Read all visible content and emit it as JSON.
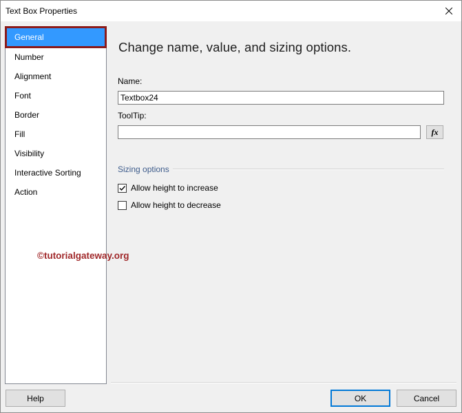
{
  "window": {
    "title": "Text Box Properties"
  },
  "nav": {
    "items": [
      {
        "label": "General",
        "selected": true
      },
      {
        "label": "Number"
      },
      {
        "label": "Alignment"
      },
      {
        "label": "Font"
      },
      {
        "label": "Border"
      },
      {
        "label": "Fill"
      },
      {
        "label": "Visibility"
      },
      {
        "label": "Interactive Sorting"
      },
      {
        "label": "Action"
      }
    ]
  },
  "main": {
    "heading": "Change name, value, and sizing options.",
    "name_label": "Name:",
    "name_value": "Textbox24",
    "tooltip_label": "ToolTip:",
    "tooltip_value": "",
    "fx_label": "fx",
    "sizing_title": "Sizing options",
    "allow_increase_label": "Allow height to increase",
    "allow_increase_checked": true,
    "allow_decrease_label": "Allow height to decrease",
    "allow_decrease_checked": false
  },
  "watermark": "©tutorialgateway.org",
  "buttons": {
    "help": "Help",
    "ok": "OK",
    "cancel": "Cancel"
  },
  "colors": {
    "selection": "#3399ff",
    "highlight_border": "#8b1a1a",
    "default_button_border": "#0078d7"
  }
}
